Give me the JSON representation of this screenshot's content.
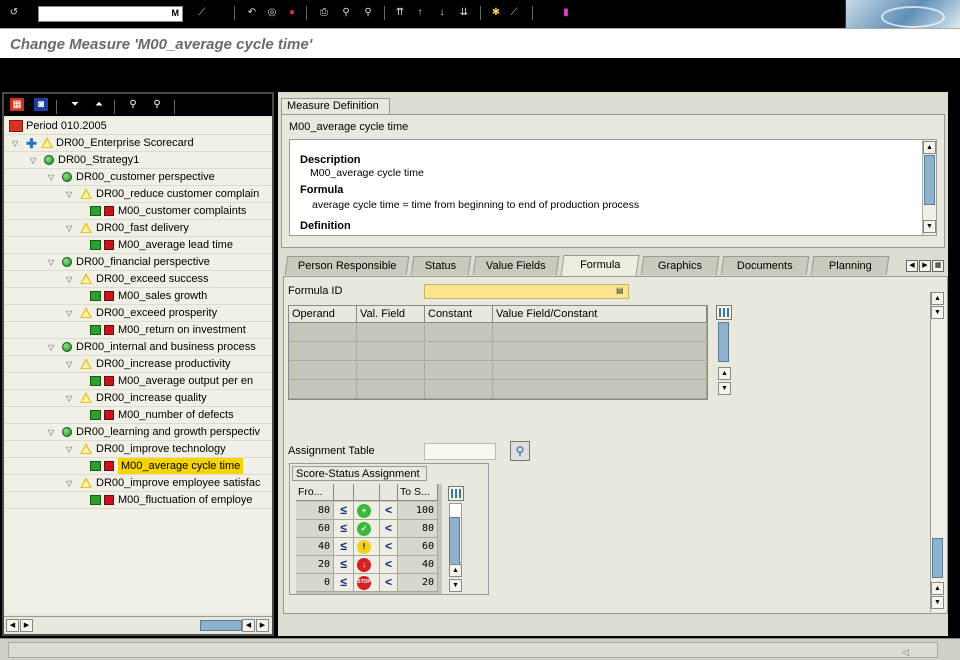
{
  "window": {
    "title": "Change Measure 'M00_average cycle time'"
  },
  "toolbar": {
    "command_value": "",
    "enter_label": "M",
    "icons": [
      "back-icon",
      "save-icon",
      "refresh-icon",
      "exit-icon",
      "cancel-icon",
      "print-icon",
      "find-icon",
      "find-next-icon",
      "first-page-icon",
      "prev-page-icon",
      "next-page-icon",
      "last-page-icon",
      "new-session-icon",
      "shortcut-icon",
      "help-icon",
      "layout-icon"
    ]
  },
  "tree": {
    "toolbar_icons": [
      "display-icon",
      "save-icon",
      "expand-icon",
      "collapse-icon",
      "find-icon",
      "find-next-icon"
    ],
    "nodes": [
      {
        "label": "Period 010.2005",
        "level": 0,
        "icon": "period-icon",
        "expander": "",
        "selected": false
      },
      {
        "label": "DR00_Enterprise Scorecard",
        "level": 0,
        "icon": "scorecard-icon",
        "expander": "open",
        "selected": false
      },
      {
        "label": "DR00_Strategy1",
        "level": 1,
        "icon": "circle",
        "expander": "open",
        "selected": false
      },
      {
        "label": "DR00_customer perspective",
        "level": 2,
        "icon": "circle",
        "expander": "open",
        "selected": false
      },
      {
        "label": "DR00_reduce customer complain",
        "level": 3,
        "icon": "tri",
        "expander": "open",
        "selected": false
      },
      {
        "label": "M00_customer complaints",
        "level": 4,
        "icon": "measure",
        "expander": "",
        "selected": false
      },
      {
        "label": "DR00_fast delivery",
        "level": 3,
        "icon": "tri",
        "expander": "open",
        "selected": false
      },
      {
        "label": "M00_average lead time",
        "level": 4,
        "icon": "measure",
        "expander": "",
        "selected": false
      },
      {
        "label": "DR00_financial perspective",
        "level": 2,
        "icon": "circle",
        "expander": "open",
        "selected": false
      },
      {
        "label": "DR00_exceed success",
        "level": 3,
        "icon": "tri",
        "expander": "open",
        "selected": false
      },
      {
        "label": "M00_sales growth",
        "level": 4,
        "icon": "measure",
        "expander": "",
        "selected": false
      },
      {
        "label": "DR00_exceed prosperity",
        "level": 3,
        "icon": "tri",
        "expander": "open",
        "selected": false
      },
      {
        "label": "M00_return on investment",
        "level": 4,
        "icon": "measure",
        "expander": "",
        "selected": false
      },
      {
        "label": "DR00_internal and business process",
        "level": 2,
        "icon": "circle",
        "expander": "open",
        "selected": false
      },
      {
        "label": "DR00_increase productivity",
        "level": 3,
        "icon": "tri",
        "expander": "open",
        "selected": false
      },
      {
        "label": "M00_average output per en",
        "level": 4,
        "icon": "measure",
        "expander": "",
        "selected": false
      },
      {
        "label": "DR00_increase quality",
        "level": 3,
        "icon": "tri",
        "expander": "open",
        "selected": false
      },
      {
        "label": "M00_number of defects",
        "level": 4,
        "icon": "measure",
        "expander": "",
        "selected": false
      },
      {
        "label": "DR00_learning and growth perspectiv",
        "level": 2,
        "icon": "circle",
        "expander": "open",
        "selected": false
      },
      {
        "label": "DR00_improve technology",
        "level": 3,
        "icon": "tri",
        "expander": "open",
        "selected": false
      },
      {
        "label": "M00_average cycle time",
        "level": 4,
        "icon": "measure",
        "expander": "",
        "selected": true
      },
      {
        "label": "DR00_improve employee satisfac",
        "level": 3,
        "icon": "tri",
        "expander": "open",
        "selected": false
      },
      {
        "label": "M00_fluctuation of employe",
        "level": 4,
        "icon": "measure",
        "expander": "",
        "selected": false
      }
    ]
  },
  "measure_definition": {
    "tab_label": "Measure Definition",
    "name": "M00_average cycle time",
    "description_heading": "Description",
    "description_text": "M00_average cycle time",
    "formula_heading": "Formula",
    "formula_text": "average cycle time = time from beginning to end of production process",
    "definition_heading": "Definition"
  },
  "tabs": [
    "Person Responsible",
    "Status",
    "Value Fields",
    "Formula",
    "Graphics",
    "Documents",
    "Planning"
  ],
  "active_tab": "Formula",
  "formula_tab": {
    "formula_id_label": "Formula ID",
    "formula_id_value": "",
    "columns": [
      "Operand",
      "Val. Field",
      "Constant",
      "Value Field/Constant"
    ],
    "rows": [
      [
        "",
        "",
        "",
        ""
      ],
      [
        "",
        "",
        "",
        ""
      ],
      [
        "",
        "",
        "",
        ""
      ],
      [
        "",
        "",
        "",
        ""
      ]
    ],
    "assignment_table_label": "Assignment Table",
    "assignment_table_value": "",
    "score_status": {
      "title": "Score-Status Assignment",
      "columns": [
        "Fro...",
        "",
        "",
        "",
        "To S..."
      ],
      "rows": [
        {
          "from": "80",
          "op1": "≤",
          "status": "green-plus",
          "op2": "<",
          "to": "100"
        },
        {
          "from": "60",
          "op1": "≤",
          "status": "green-check",
          "op2": "<",
          "to": "80"
        },
        {
          "from": "40",
          "op1": "≤",
          "status": "yellow-exclaim",
          "op2": "<",
          "to": "60"
        },
        {
          "from": "20",
          "op1": "≤",
          "status": "red-minus",
          "op2": "<",
          "to": "40"
        },
        {
          "from": "0",
          "op1": "≤",
          "status": "red-stop",
          "op2": "<",
          "to": "20"
        }
      ],
      "status_glyphs": {
        "green-plus": "+",
        "green-check": "✓",
        "yellow-exclaim": "!",
        "red-minus": "↓",
        "red-stop": "STOP"
      },
      "status_colors": {
        "green-plus": "#3cb83c",
        "green-check": "#3cb83c",
        "yellow-exclaim": "#f2d21b",
        "red-minus": "#d42020",
        "red-stop": "#d42020"
      }
    }
  },
  "colors": {
    "selection": "#f5d400",
    "input_required": "#fbe58e",
    "title_text": "#6a6a6a"
  }
}
